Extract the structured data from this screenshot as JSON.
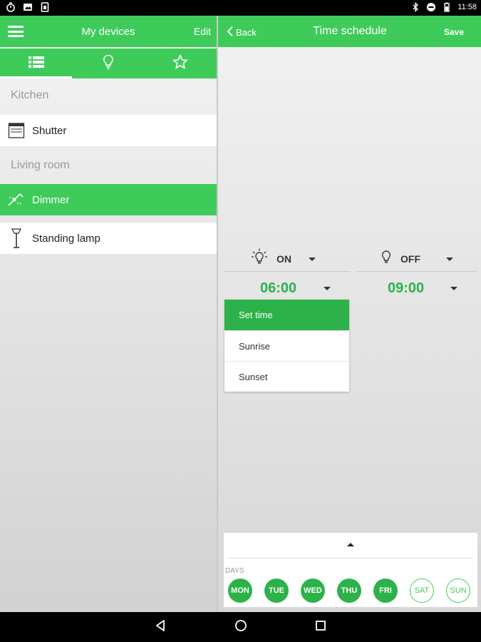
{
  "status_bar": {
    "time": "11:58",
    "left_icons": [
      "timer-icon",
      "image-icon",
      "sim-icon"
    ],
    "right_icons": [
      "bluetooth-icon",
      "do-not-disturb-icon",
      "battery-icon"
    ]
  },
  "left_panel": {
    "title": "My devices",
    "edit_label": "Edit",
    "tabs": [
      {
        "icon": "list-icon",
        "active": true
      },
      {
        "icon": "bulb-icon",
        "active": false
      },
      {
        "icon": "star-icon",
        "active": false
      }
    ],
    "sections": [
      {
        "label": "Kitchen",
        "devices": [
          {
            "label": "Shutter",
            "icon": "shutter-icon",
            "active": false
          }
        ]
      },
      {
        "label": "Living room",
        "devices": [
          {
            "label": "Dimmer",
            "icon": "dimmer-icon",
            "active": true
          },
          {
            "label": "Standing lamp",
            "icon": "standing-lamp-icon",
            "active": false
          }
        ]
      }
    ]
  },
  "right_panel": {
    "back_label": "Back",
    "title": "Time schedule",
    "save_label": "Save",
    "on": {
      "label": "ON",
      "time": "06:00",
      "icon": "bulb-on-icon"
    },
    "off": {
      "label": "OFF",
      "time": "09:00",
      "icon": "bulb-off-icon"
    },
    "dropdown": {
      "options": [
        "Set time",
        "Sunrise",
        "Sunset"
      ],
      "selected": "Set time"
    },
    "days": {
      "label": "DAYS",
      "items": [
        {
          "label": "MON",
          "on": true
        },
        {
          "label": "TUE",
          "on": true
        },
        {
          "label": "WED",
          "on": true
        },
        {
          "label": "THU",
          "on": true
        },
        {
          "label": "FRI",
          "on": true
        },
        {
          "label": "SAT",
          "on": false
        },
        {
          "label": "SUN",
          "on": false
        }
      ]
    }
  },
  "colors": {
    "accent": "#3ecb5a",
    "accent_dark": "#2db24a"
  }
}
